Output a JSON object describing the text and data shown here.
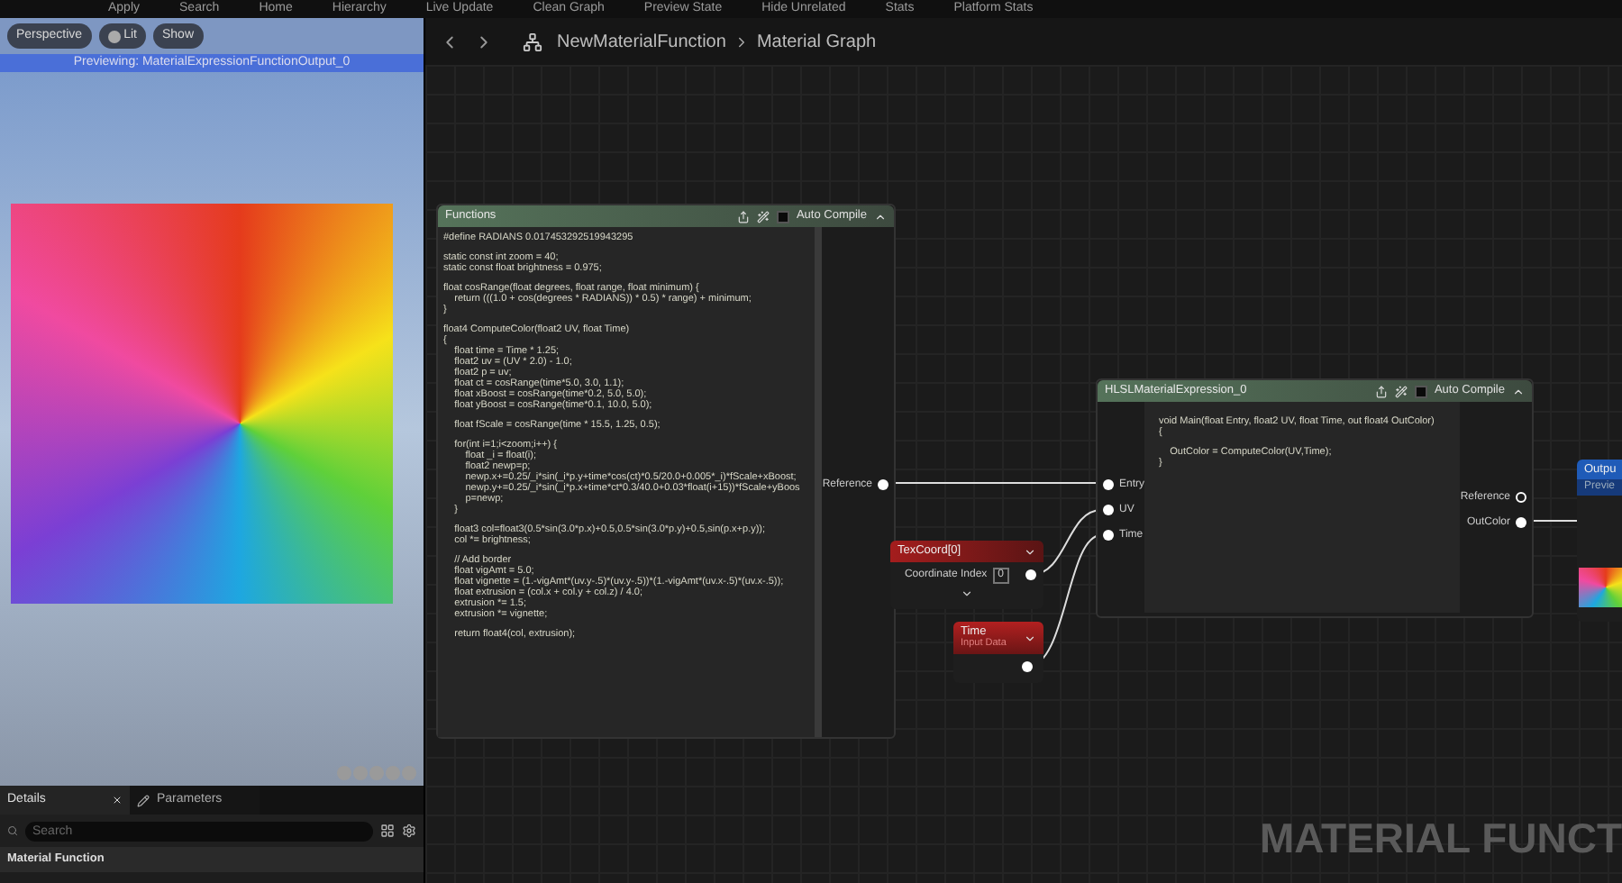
{
  "toolbar": {
    "items": [
      "Apply",
      "Search",
      "Home",
      "Hierarchy",
      "Live Update",
      "Clean Graph",
      "Preview State",
      "Hide Unrelated",
      "Stats",
      "Platform Stats"
    ]
  },
  "viewport": {
    "buttons": [
      {
        "label": "Perspective",
        "kind": "text"
      },
      {
        "label": "Lit",
        "kind": "icon"
      },
      {
        "label": "Show",
        "kind": "text"
      }
    ],
    "banner": "Previewing: MaterialExpressionFunctionOutput_0"
  },
  "details_panel": {
    "tabs": [
      {
        "label": "Details",
        "selected": true,
        "kind": "closable"
      },
      {
        "label": "Parameters",
        "selected": false,
        "kind": "pencil"
      }
    ],
    "search": {
      "placeholder": "Search"
    },
    "section": "Material Function"
  },
  "breadcrumb": [
    "NewMaterialFunction",
    "Material Graph"
  ],
  "graph": {
    "functions_node": {
      "title": "Functions",
      "auto_compile": {
        "label": "Auto Compile",
        "checked": false
      },
      "code": [
        [
          "#define RADIANS 0.017453292519943295"
        ],
        [
          "static const int zoom = 40;",
          "static const float brightness = 0.975;"
        ],
        [
          "float cosRange(float degrees, float range, float minimum) {",
          "    return (((1.0 + cos(degrees * RADIANS)) * 0.5) * range) + minimum;",
          "}"
        ],
        [
          "float4 ComputeColor(float2 UV, float Time)",
          "{",
          "    float time = Time * 1.25;",
          "    float2 uv = (UV * 2.0) - 1.0;",
          "    float2 p = uv;",
          "    float ct = cosRange(time*5.0, 3.0, 1.1);",
          "    float xBoost = cosRange(time*0.2, 5.0, 5.0);",
          "    float yBoost = cosRange(time*0.1, 10.0, 5.0);"
        ],
        [
          "    float fScale = cosRange(time * 15.5, 1.25, 0.5);"
        ],
        [
          "    for(int i=1;i<zoom;i++) {",
          "        float _i = float(i);",
          "        float2 newp=p;",
          "        newp.x+=0.25/_i*sin(_i*p.y+time*cos(ct)*0.5/20.0+0.005*_i)*fScale+xBoost;",
          "        newp.y+=0.25/_i*sin(_i*p.x+time*ct*0.3/40.0+0.03*float(i+15))*fScale+yBoos",
          "        p=newp;",
          "    }"
        ],
        [
          "    float3 col=float3(0.5*sin(3.0*p.x)+0.5,0.5*sin(3.0*p.y)+0.5,sin(p.x+p.y));",
          "    col *= brightness;"
        ],
        [
          "    // Add border",
          "    float vigAmt = 5.0;",
          "    float vignette = (1.-vigAmt*(uv.y-.5)*(uv.y-.5))*(1.-vigAmt*(uv.x-.5)*(uv.x-.5));",
          "    float extrusion = (col.x + col.y + col.z) / 4.0;",
          "    extrusion *= 1.5;",
          "    extrusion *= vignette;"
        ],
        [
          "    return float4(col, extrusion);"
        ]
      ],
      "outputs": [
        {
          "label": "Reference",
          "connected": true
        }
      ]
    },
    "texcoord_node": {
      "title": "TexCoord[0]",
      "param": "Coordinate Index",
      "value": "0"
    },
    "time_node": {
      "title": "Time",
      "subtitle": "Input Data"
    },
    "hlsl_node": {
      "title": "HLSLMaterialExpression_0",
      "auto_compile": {
        "label": "Auto Compile",
        "checked": false
      },
      "code": [
        [
          "void Main(float Entry, float2 UV, float Time, out float4 OutColor)",
          "{"
        ],
        [
          "    OutColor = ComputeColor(UV,Time);",
          "}"
        ]
      ],
      "inputs": [
        {
          "label": "Entry",
          "connected": true
        },
        {
          "label": "UV",
          "connected": true
        },
        {
          "label": "Time",
          "connected": true
        }
      ],
      "outputs": [
        {
          "label": "Reference",
          "connected": false
        },
        {
          "label": "OutColor",
          "connected": true
        }
      ]
    },
    "output_node": {
      "title": "Outpu",
      "subtitle": "Previe"
    },
    "graph_label": "MATERIAL FUNCT"
  }
}
